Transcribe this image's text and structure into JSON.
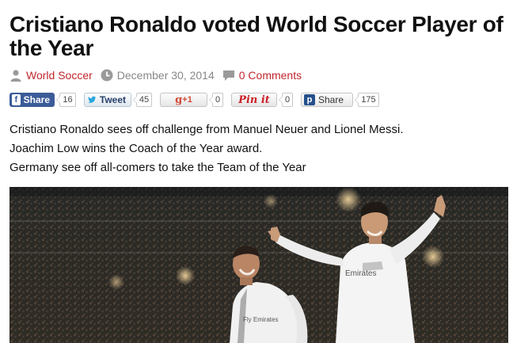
{
  "article": {
    "title": "Cristiano Ronaldo voted World Soccer Player of the Year",
    "category": "World Soccer",
    "date": "December 30, 2014",
    "comments": "0 Comments",
    "summary": [
      "Cristiano Ronaldo sees off challenge from Manuel Neuer and Lionel Messi.",
      "Joachim Low wins the Coach of the Year award.",
      "Germany see off all-comers to take the Team of the Year"
    ],
    "photo_text": {
      "sponsor_right": "Emirates",
      "sponsor_left": "Fly Emirates"
    }
  },
  "share_bar": {
    "facebook": {
      "label": "Share",
      "icon": "f",
      "count": "16"
    },
    "twitter": {
      "label": "Tweet",
      "icon": "bird",
      "count": "45"
    },
    "googleplus": {
      "label": "+1",
      "icon": "g",
      "count": "0"
    },
    "pinterest": {
      "label": "Pin it",
      "count": "0"
    },
    "pocket": {
      "label": "Share",
      "icon": "p",
      "count": "175"
    }
  },
  "colors": {
    "link": "#c0272d",
    "facebook": "#3b5b98",
    "meta_gray": "#888888"
  }
}
